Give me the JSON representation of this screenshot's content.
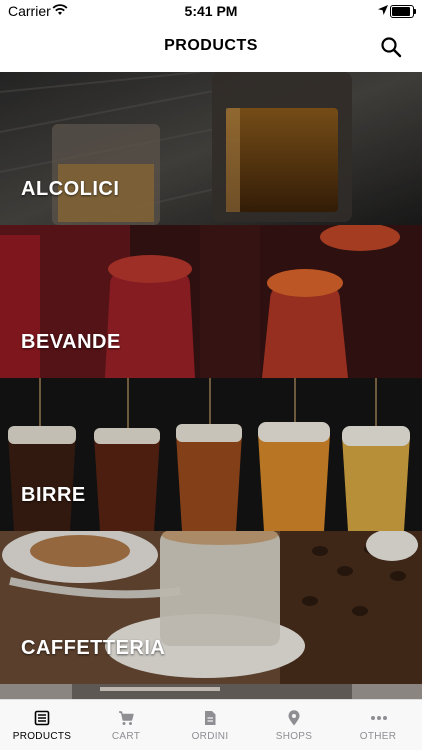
{
  "status_bar": {
    "carrier": "Carrier",
    "time": "5:41 PM"
  },
  "header": {
    "title": "PRODUCTS"
  },
  "categories": [
    {
      "label": "ALCOLICI"
    },
    {
      "label": "BEVANDE"
    },
    {
      "label": "BIRRE"
    },
    {
      "label": "CAFFETTERIA"
    }
  ],
  "tabbar": {
    "items": [
      {
        "label": "PRODUCTS",
        "icon": "products-icon",
        "active": true
      },
      {
        "label": "CART",
        "icon": "cart-icon",
        "active": false
      },
      {
        "label": "ORDINI",
        "icon": "document-icon",
        "active": false
      },
      {
        "label": "SHOPS",
        "icon": "location-pin-icon",
        "active": false
      },
      {
        "label": "OTHER",
        "icon": "more-icon",
        "active": false
      }
    ]
  }
}
